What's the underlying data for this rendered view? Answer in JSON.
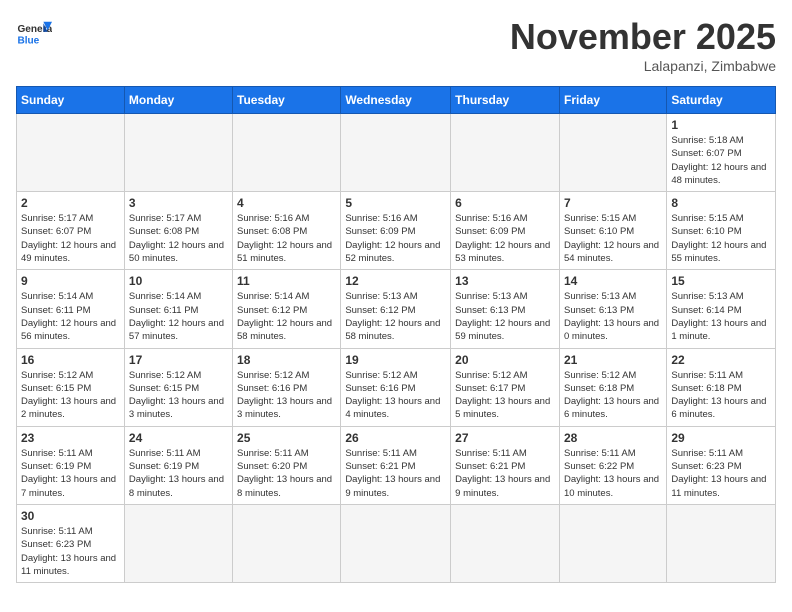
{
  "header": {
    "logo_general": "General",
    "logo_blue": "Blue",
    "month_title": "November 2025",
    "subtitle": "Lalapanzi, Zimbabwe"
  },
  "days_of_week": [
    "Sunday",
    "Monday",
    "Tuesday",
    "Wednesday",
    "Thursday",
    "Friday",
    "Saturday"
  ],
  "weeks": [
    [
      {
        "day": "",
        "info": ""
      },
      {
        "day": "",
        "info": ""
      },
      {
        "day": "",
        "info": ""
      },
      {
        "day": "",
        "info": ""
      },
      {
        "day": "",
        "info": ""
      },
      {
        "day": "",
        "info": ""
      },
      {
        "day": "1",
        "info": "Sunrise: 5:18 AM\nSunset: 6:07 PM\nDaylight: 12 hours and 48 minutes."
      }
    ],
    [
      {
        "day": "2",
        "info": "Sunrise: 5:17 AM\nSunset: 6:07 PM\nDaylight: 12 hours and 49 minutes."
      },
      {
        "day": "3",
        "info": "Sunrise: 5:17 AM\nSunset: 6:08 PM\nDaylight: 12 hours and 50 minutes."
      },
      {
        "day": "4",
        "info": "Sunrise: 5:16 AM\nSunset: 6:08 PM\nDaylight: 12 hours and 51 minutes."
      },
      {
        "day": "5",
        "info": "Sunrise: 5:16 AM\nSunset: 6:09 PM\nDaylight: 12 hours and 52 minutes."
      },
      {
        "day": "6",
        "info": "Sunrise: 5:16 AM\nSunset: 6:09 PM\nDaylight: 12 hours and 53 minutes."
      },
      {
        "day": "7",
        "info": "Sunrise: 5:15 AM\nSunset: 6:10 PM\nDaylight: 12 hours and 54 minutes."
      },
      {
        "day": "8",
        "info": "Sunrise: 5:15 AM\nSunset: 6:10 PM\nDaylight: 12 hours and 55 minutes."
      }
    ],
    [
      {
        "day": "9",
        "info": "Sunrise: 5:14 AM\nSunset: 6:11 PM\nDaylight: 12 hours and 56 minutes."
      },
      {
        "day": "10",
        "info": "Sunrise: 5:14 AM\nSunset: 6:11 PM\nDaylight: 12 hours and 57 minutes."
      },
      {
        "day": "11",
        "info": "Sunrise: 5:14 AM\nSunset: 6:12 PM\nDaylight: 12 hours and 58 minutes."
      },
      {
        "day": "12",
        "info": "Sunrise: 5:13 AM\nSunset: 6:12 PM\nDaylight: 12 hours and 58 minutes."
      },
      {
        "day": "13",
        "info": "Sunrise: 5:13 AM\nSunset: 6:13 PM\nDaylight: 12 hours and 59 minutes."
      },
      {
        "day": "14",
        "info": "Sunrise: 5:13 AM\nSunset: 6:13 PM\nDaylight: 13 hours and 0 minutes."
      },
      {
        "day": "15",
        "info": "Sunrise: 5:13 AM\nSunset: 6:14 PM\nDaylight: 13 hours and 1 minute."
      }
    ],
    [
      {
        "day": "16",
        "info": "Sunrise: 5:12 AM\nSunset: 6:15 PM\nDaylight: 13 hours and 2 minutes."
      },
      {
        "day": "17",
        "info": "Sunrise: 5:12 AM\nSunset: 6:15 PM\nDaylight: 13 hours and 3 minutes."
      },
      {
        "day": "18",
        "info": "Sunrise: 5:12 AM\nSunset: 6:16 PM\nDaylight: 13 hours and 3 minutes."
      },
      {
        "day": "19",
        "info": "Sunrise: 5:12 AM\nSunset: 6:16 PM\nDaylight: 13 hours and 4 minutes."
      },
      {
        "day": "20",
        "info": "Sunrise: 5:12 AM\nSunset: 6:17 PM\nDaylight: 13 hours and 5 minutes."
      },
      {
        "day": "21",
        "info": "Sunrise: 5:12 AM\nSunset: 6:18 PM\nDaylight: 13 hours and 6 minutes."
      },
      {
        "day": "22",
        "info": "Sunrise: 5:11 AM\nSunset: 6:18 PM\nDaylight: 13 hours and 6 minutes."
      }
    ],
    [
      {
        "day": "23",
        "info": "Sunrise: 5:11 AM\nSunset: 6:19 PM\nDaylight: 13 hours and 7 minutes."
      },
      {
        "day": "24",
        "info": "Sunrise: 5:11 AM\nSunset: 6:19 PM\nDaylight: 13 hours and 8 minutes."
      },
      {
        "day": "25",
        "info": "Sunrise: 5:11 AM\nSunset: 6:20 PM\nDaylight: 13 hours and 8 minutes."
      },
      {
        "day": "26",
        "info": "Sunrise: 5:11 AM\nSunset: 6:21 PM\nDaylight: 13 hours and 9 minutes."
      },
      {
        "day": "27",
        "info": "Sunrise: 5:11 AM\nSunset: 6:21 PM\nDaylight: 13 hours and 9 minutes."
      },
      {
        "day": "28",
        "info": "Sunrise: 5:11 AM\nSunset: 6:22 PM\nDaylight: 13 hours and 10 minutes."
      },
      {
        "day": "29",
        "info": "Sunrise: 5:11 AM\nSunset: 6:23 PM\nDaylight: 13 hours and 11 minutes."
      }
    ],
    [
      {
        "day": "30",
        "info": "Sunrise: 5:11 AM\nSunset: 6:23 PM\nDaylight: 13 hours and 11 minutes."
      },
      {
        "day": "",
        "info": ""
      },
      {
        "day": "",
        "info": ""
      },
      {
        "day": "",
        "info": ""
      },
      {
        "day": "",
        "info": ""
      },
      {
        "day": "",
        "info": ""
      },
      {
        "day": "",
        "info": ""
      }
    ]
  ]
}
